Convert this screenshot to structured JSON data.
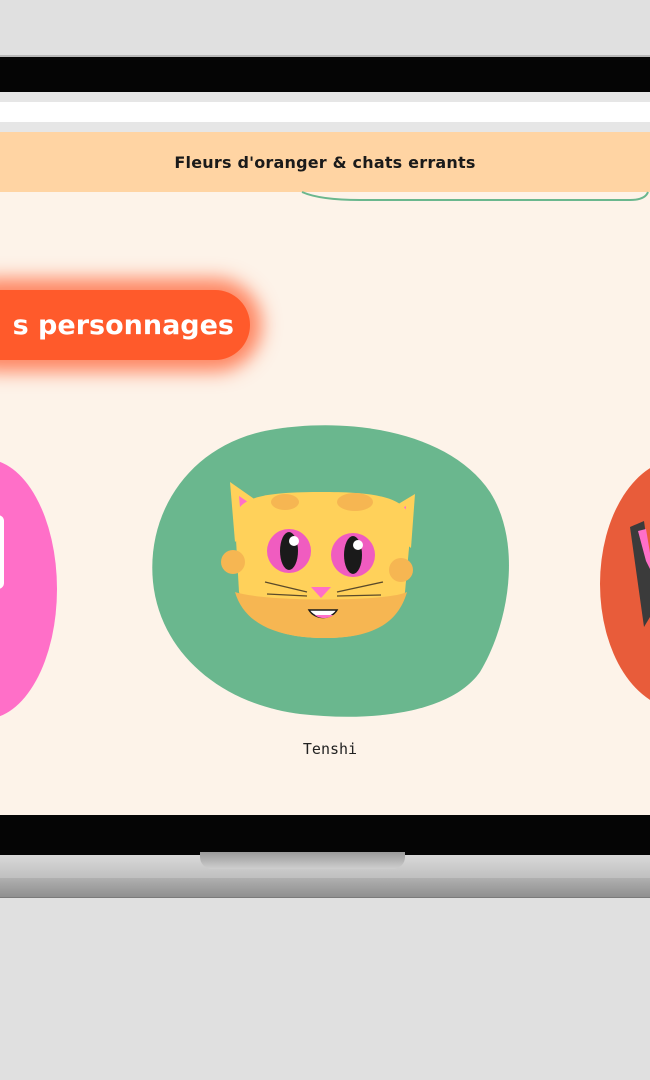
{
  "site": {
    "title": "Fleurs d'oranger & chats errants"
  },
  "section": {
    "heading": "s personnages"
  },
  "characters": [
    {
      "name": "",
      "color": "#ff6fc8"
    },
    {
      "name": "Tenshi",
      "color": "#6ab78e",
      "avatar_icon": "yellow-cat-face-icon"
    },
    {
      "name": "",
      "color": "#e85c3a"
    }
  ],
  "colors": {
    "page_bg": "#fdf3e9",
    "header_bg": "#ffd4a3",
    "accent": "#ff5a2b"
  }
}
